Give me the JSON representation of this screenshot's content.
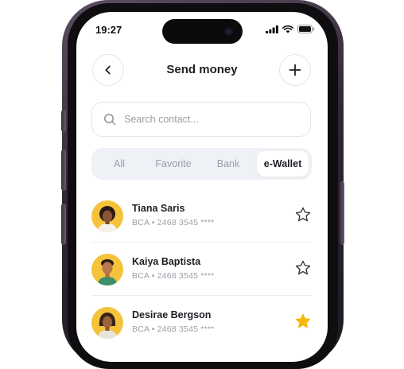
{
  "status": {
    "time": "19:27"
  },
  "header": {
    "title": "Send money"
  },
  "search": {
    "placeholder": "Search contact..."
  },
  "tabs": [
    {
      "label": "All",
      "active": false
    },
    {
      "label": "Favorite",
      "active": false
    },
    {
      "label": "Bank",
      "active": false
    },
    {
      "label": "e-Wallet",
      "active": true
    }
  ],
  "contacts": [
    {
      "name": "Tiana Saris",
      "account": "BCA • 2468 3545 ****",
      "favorite": false
    },
    {
      "name": "Kaiya Baptista",
      "account": "BCA • 2468 3545 ****",
      "favorite": false
    },
    {
      "name": "Desirae Bergson",
      "account": "BCA • 2468 3545 ****",
      "favorite": true
    }
  ],
  "colors": {
    "accent_star": "#f6b80e",
    "avatar_bg": "#f5c33b",
    "tab_track": "#eef1f5"
  },
  "icons": {
    "back": "chevron-left-icon",
    "add": "plus-icon",
    "search": "search-icon",
    "favorite": "star-icon",
    "signal": "signal-icon",
    "wifi": "wifi-icon",
    "battery": "battery-icon"
  }
}
